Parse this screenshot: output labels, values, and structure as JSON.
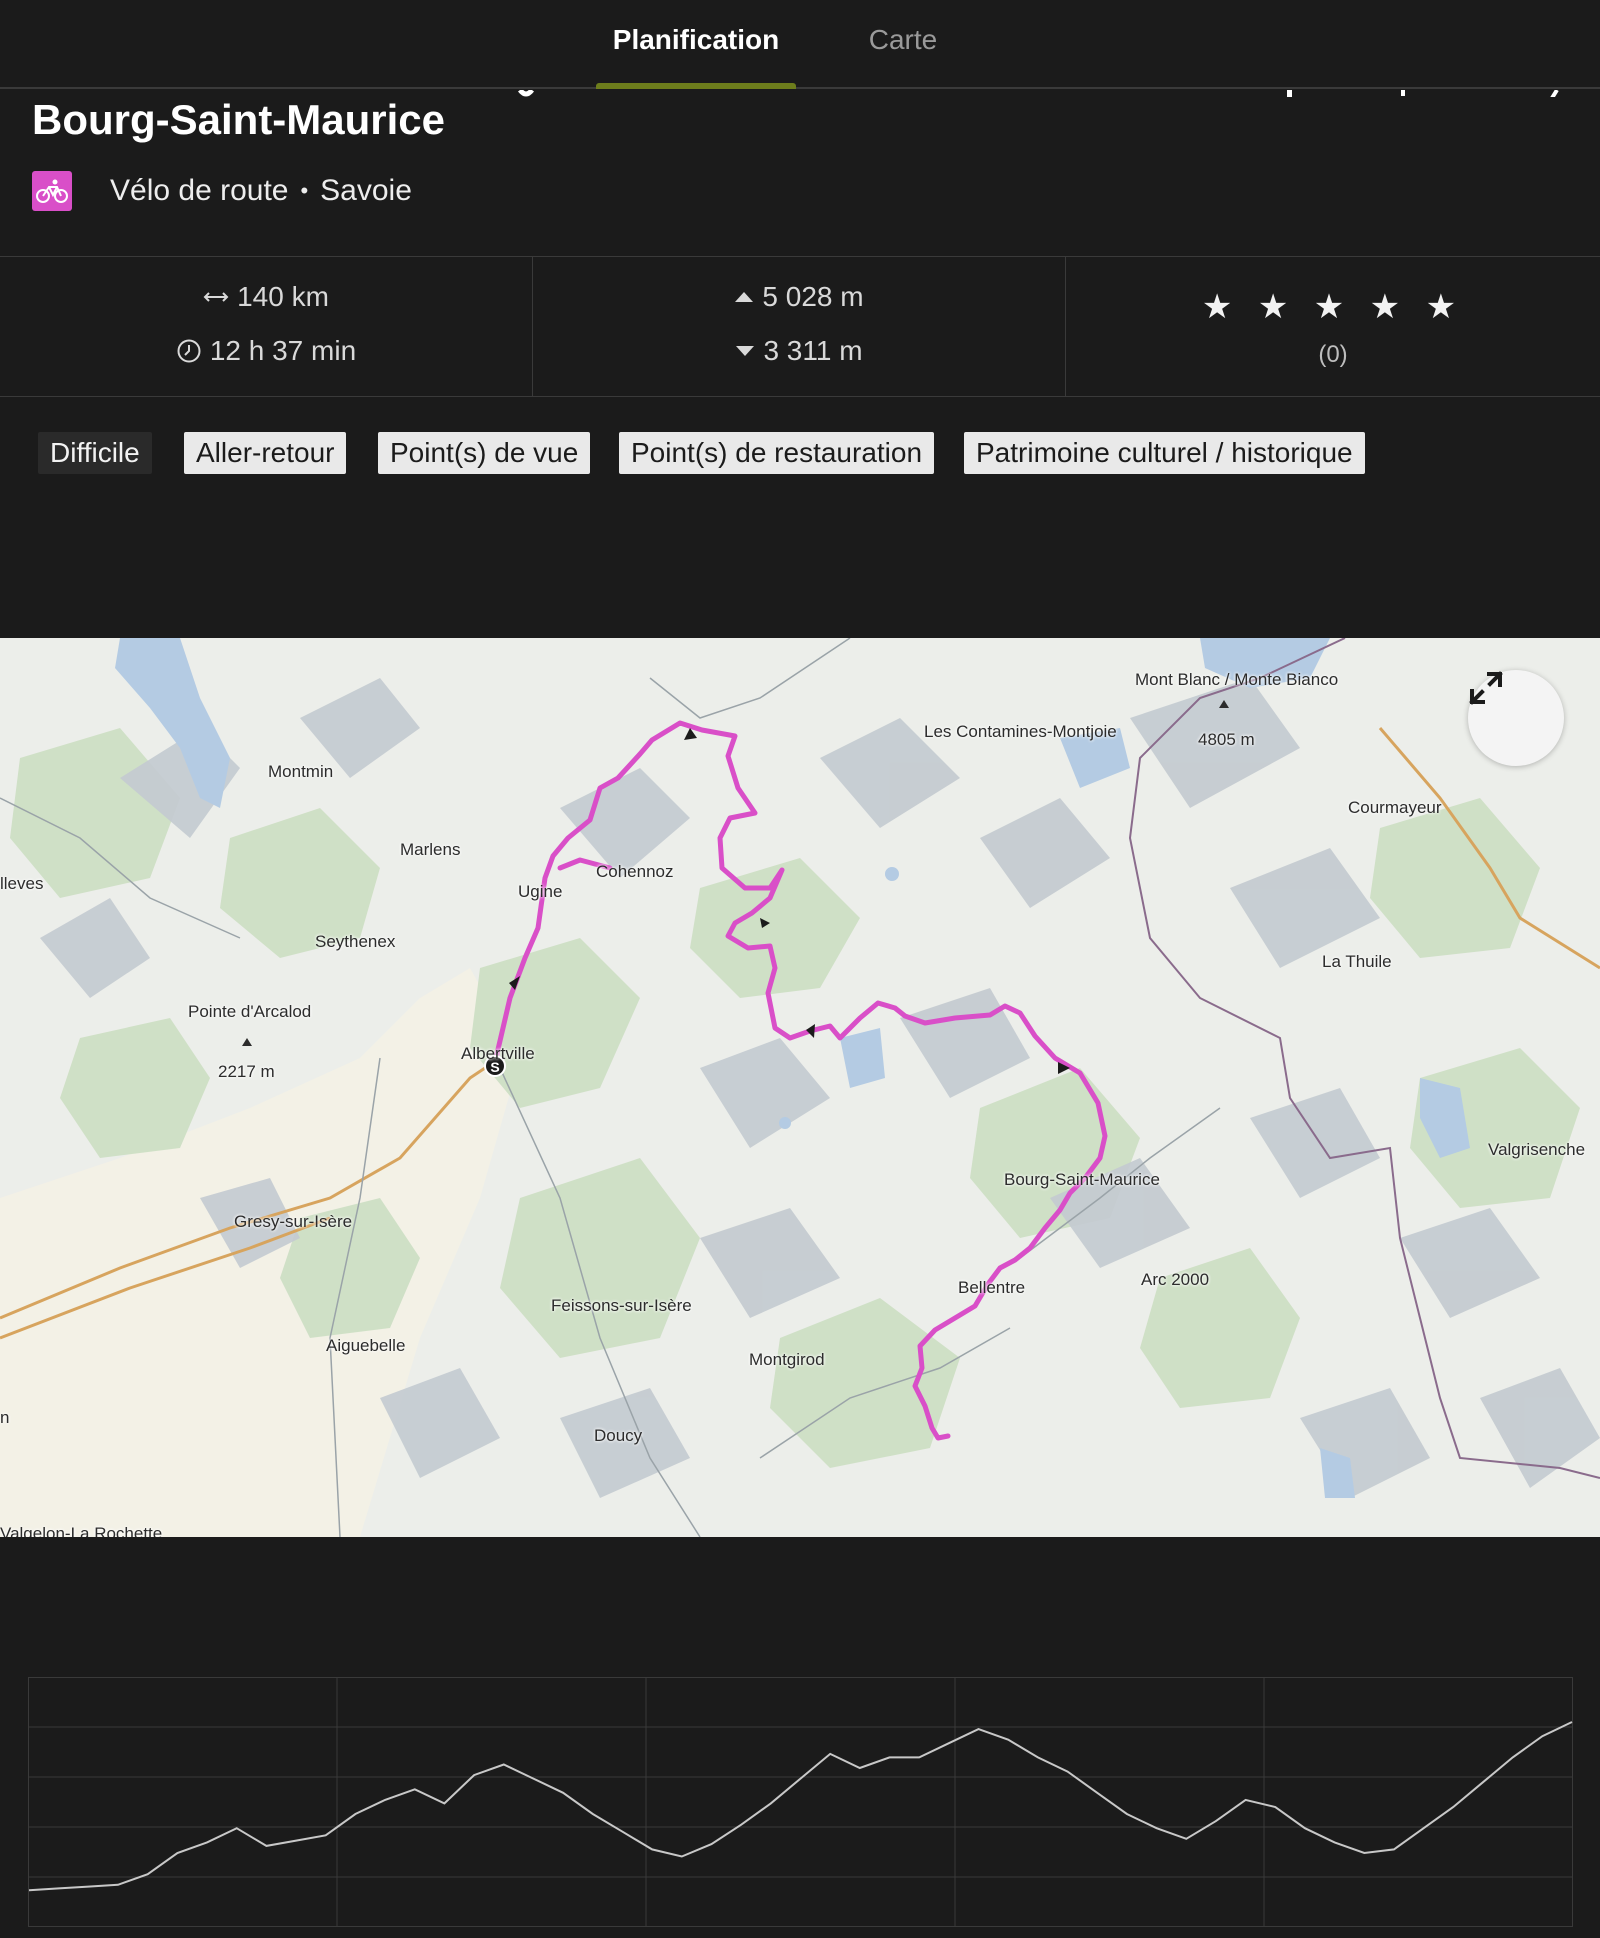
{
  "tabs": [
    {
      "label": "Planification",
      "active": true
    },
    {
      "label": "Carte",
      "active": false
    }
  ],
  "route": {
    "title": "Bourg-Saint-Maurice",
    "activity": "Vélo de route",
    "region": "Savoie",
    "activity_icon": "road-bike-icon",
    "accent_color": "#d94fc8"
  },
  "stats": {
    "distance": "140 km",
    "duration": "12 h 37 min",
    "ascent": "5 028 m",
    "descent": "3 311 m",
    "rating_stars": "★ ★ ★ ★ ★",
    "rating_count": "(0)"
  },
  "tags": [
    "Difficile",
    "Aller-retour",
    "Point(s) de vue",
    "Point(s) de restauration",
    "Patrimoine culturel / historique"
  ],
  "map": {
    "route_color": "#d94fc8",
    "expand_icon": "expand-icon",
    "start_marker": "S",
    "labels": [
      "Montmin",
      "Marlens",
      "Ugine",
      "Cohennoz",
      "Seythenex",
      "Pointe d'Arcalod",
      "2217 m",
      "Albertville",
      "Gresy-sur-Isère",
      "Aiguebelle",
      "Feissons-sur-Isère",
      "Doucy",
      "Montgirod",
      "Bellentre",
      "Bourg-Saint-Maurice",
      "Arc 2000",
      "Les Contamines-Montjoie",
      "Mont Blanc / Monte Bianco",
      "4805 m",
      "Courmayeur",
      "La Thuile",
      "Valgrisenche",
      "lleves",
      "Valgelon-La Rochette",
      "n"
    ]
  },
  "elevation": {
    "line_color": "#c8c8c8",
    "profile": [
      0.05,
      0.06,
      0.07,
      0.08,
      0.14,
      0.26,
      0.32,
      0.4,
      0.3,
      0.33,
      0.36,
      0.48,
      0.56,
      0.62,
      0.54,
      0.7,
      0.76,
      0.68,
      0.6,
      0.48,
      0.38,
      0.28,
      0.24,
      0.31,
      0.42,
      0.54,
      0.68,
      0.82,
      0.74,
      0.8,
      0.8,
      0.88,
      0.96,
      0.9,
      0.8,
      0.72,
      0.6,
      0.48,
      0.4,
      0.34,
      0.44,
      0.56,
      0.52,
      0.4,
      0.32,
      0.26,
      0.28,
      0.4,
      0.52,
      0.66,
      0.8,
      0.92,
      1.0
    ]
  }
}
